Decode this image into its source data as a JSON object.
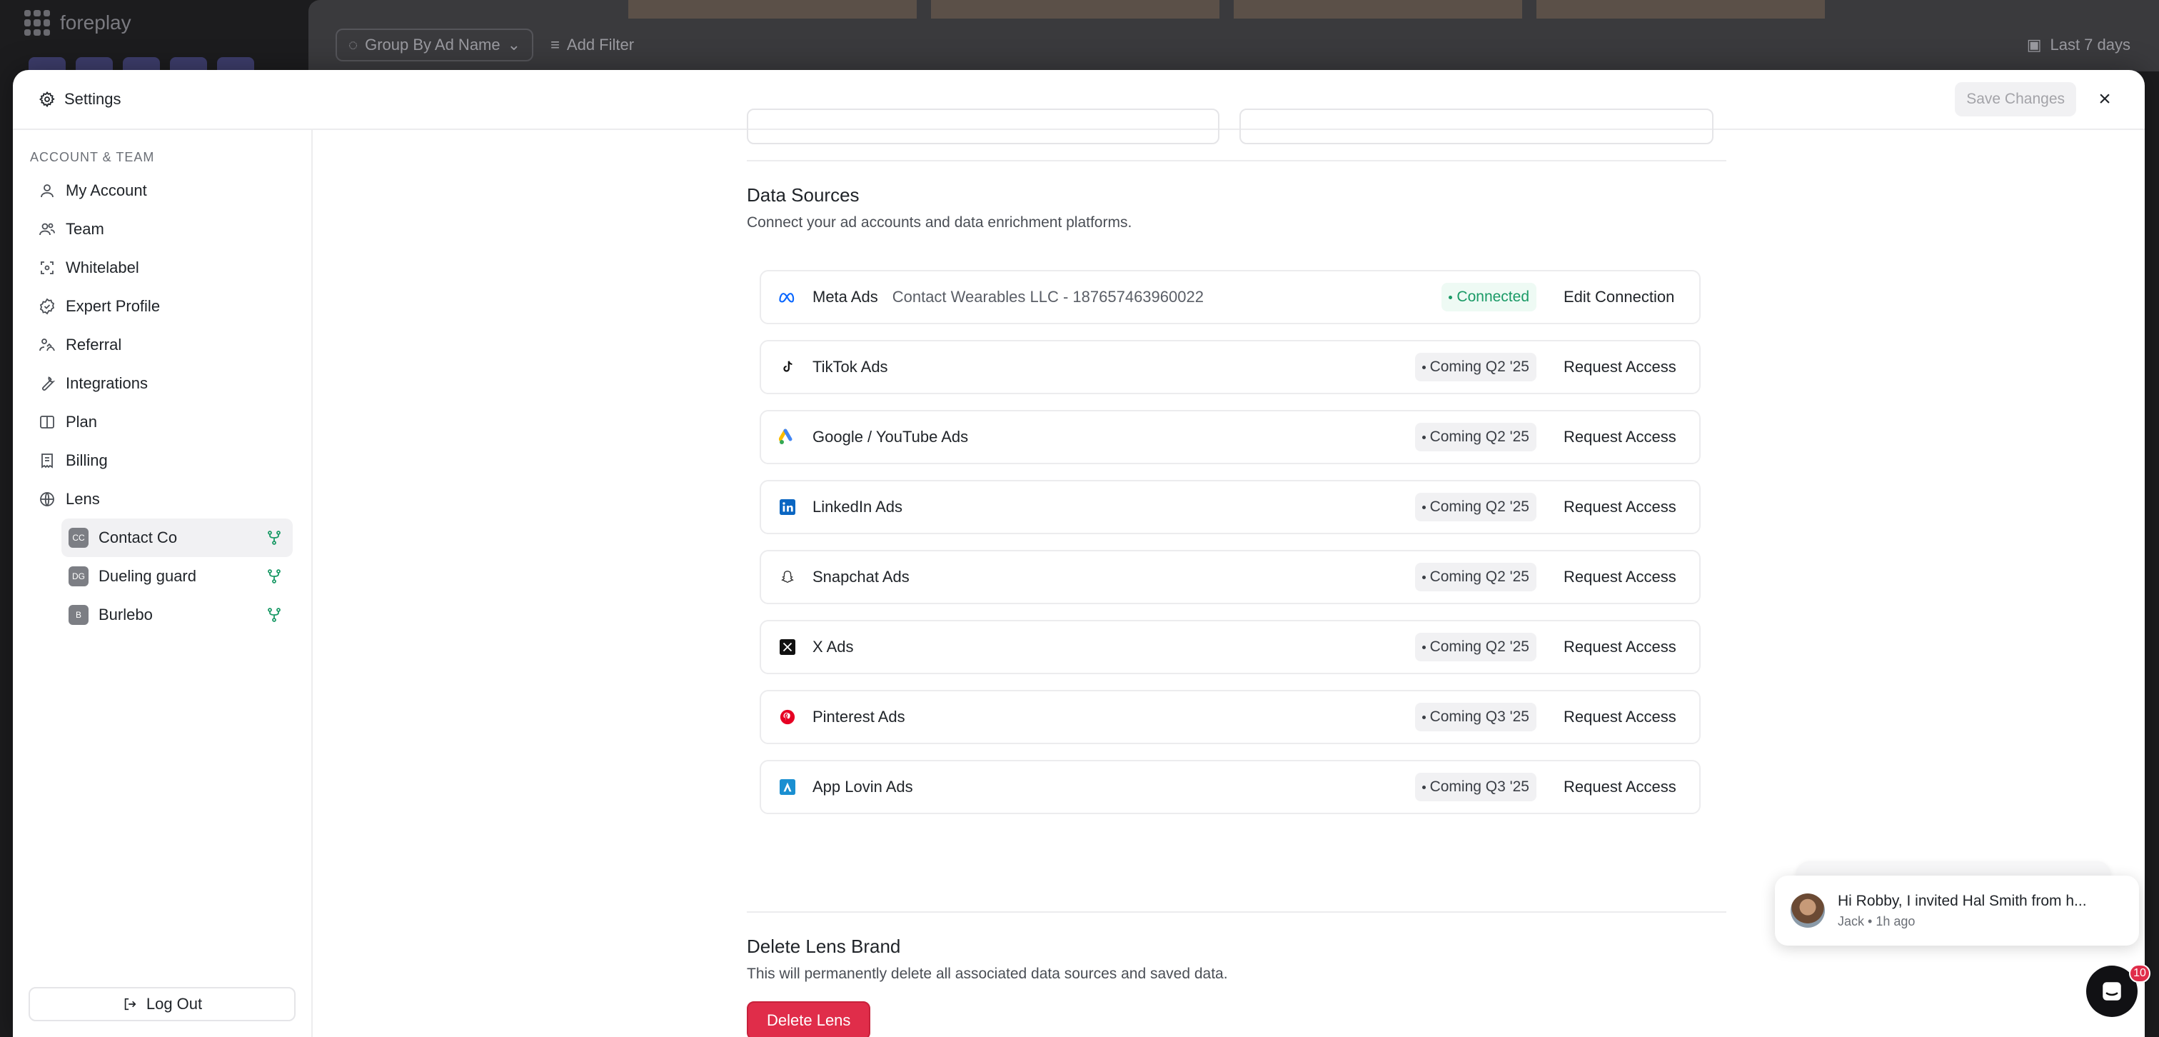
{
  "background": {
    "logo_text": "foreplay",
    "toolbar": {
      "group_by": "Group By Ad Name",
      "add_filter": "Add Filter",
      "date_range": "Last 7 days"
    }
  },
  "modal": {
    "title": "Settings",
    "save_label": "Save Changes",
    "close_icon": "close-icon"
  },
  "sidebar": {
    "section_label": "ACCOUNT & TEAM",
    "items": [
      {
        "label": "My Account",
        "icon": "user-icon"
      },
      {
        "label": "Team",
        "icon": "users-icon"
      },
      {
        "label": "Whitelabel",
        "icon": "whitelabel-icon"
      },
      {
        "label": "Expert Profile",
        "icon": "badge-check-icon"
      },
      {
        "label": "Referral",
        "icon": "referral-icon"
      },
      {
        "label": "Integrations",
        "icon": "wrench-icon"
      },
      {
        "label": "Plan",
        "icon": "book-icon"
      },
      {
        "label": "Billing",
        "icon": "receipt-icon"
      },
      {
        "label": "Lens",
        "icon": "globe-icon"
      }
    ],
    "lenses": [
      {
        "initials": "CC",
        "name": "Contact Co",
        "active": true
      },
      {
        "initials": "DG",
        "name": "Dueling guard",
        "active": false
      },
      {
        "initials": "B",
        "name": "Burlebo",
        "active": false
      }
    ],
    "logout_label": "Log Out"
  },
  "data_sources": {
    "title": "Data Sources",
    "description": "Connect your ad accounts and data enrichment platforms.",
    "rows": [
      {
        "name": "Meta Ads",
        "account": "Contact Wearables LLC - 187657463960022",
        "status": "Connected",
        "action": "Edit Connection",
        "icon": "meta-icon"
      },
      {
        "name": "TikTok Ads",
        "account": "",
        "status": "Coming Q2 '25",
        "action": "Request Access",
        "icon": "tiktok-icon"
      },
      {
        "name": "Google / YouTube Ads",
        "account": "",
        "status": "Coming Q2 '25",
        "action": "Request Access",
        "icon": "google-ads-icon"
      },
      {
        "name": "LinkedIn Ads",
        "account": "",
        "status": "Coming Q2 '25",
        "action": "Request Access",
        "icon": "linkedin-icon"
      },
      {
        "name": "Snapchat Ads",
        "account": "",
        "status": "Coming Q2 '25",
        "action": "Request Access",
        "icon": "snapchat-icon"
      },
      {
        "name": "X Ads",
        "account": "",
        "status": "Coming Q2 '25",
        "action": "Request Access",
        "icon": "x-icon"
      },
      {
        "name": "Pinterest Ads",
        "account": "",
        "status": "Coming Q3 '25",
        "action": "Request Access",
        "icon": "pinterest-icon"
      },
      {
        "name": "App Lovin Ads",
        "account": "",
        "status": "Coming Q3 '25",
        "action": "Request Access",
        "icon": "applovin-icon"
      }
    ]
  },
  "delete_section": {
    "title": "Delete Lens Brand",
    "description": "This will permanently delete all associated data sources and saved data.",
    "button_label": "Delete Lens"
  },
  "chat": {
    "message": "Hi Robby, I invited Hal Smith from h...",
    "meta": "Jack • 1h ago",
    "unread_count": "10"
  },
  "colors": {
    "connected": "#1a9a66",
    "danger": "#e02d4a",
    "muted": "#a3a3a8"
  }
}
